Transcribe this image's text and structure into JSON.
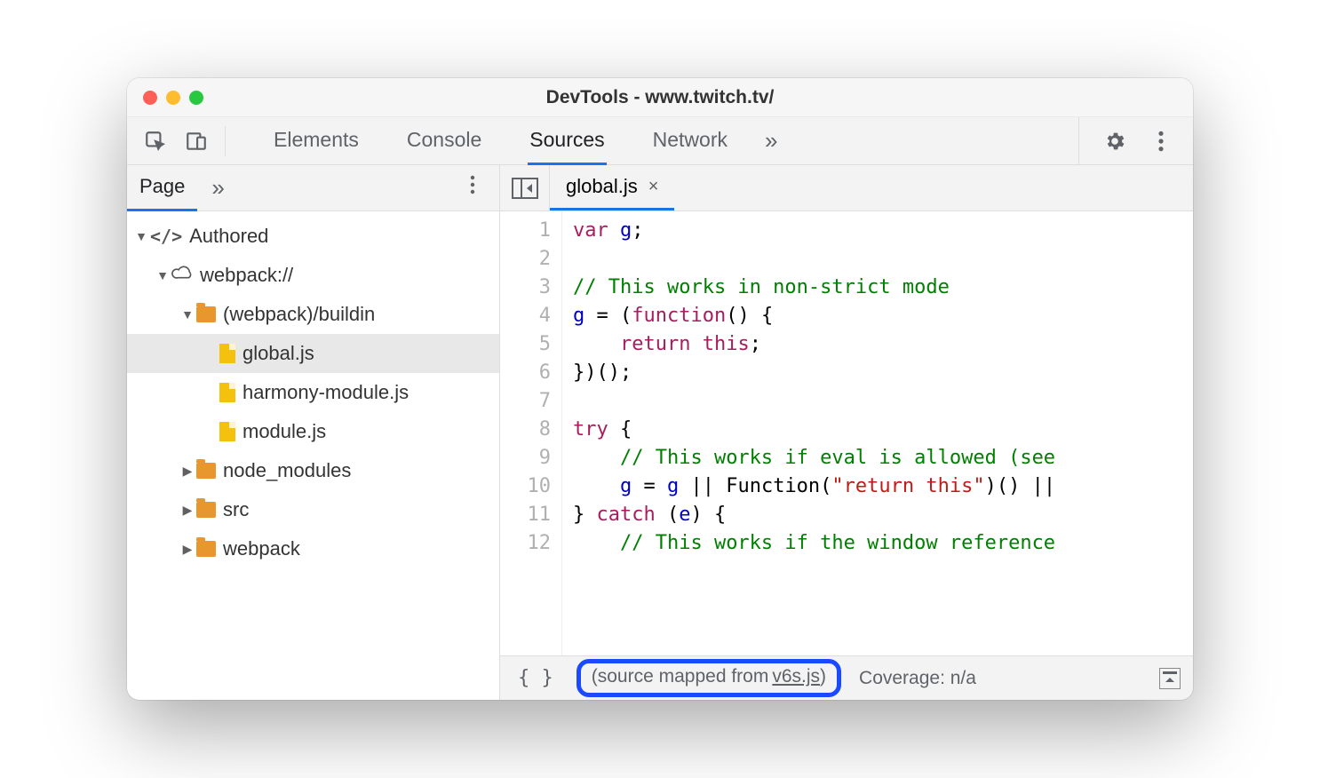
{
  "window": {
    "title": "DevTools - www.twitch.tv/"
  },
  "tabs": {
    "items": [
      "Elements",
      "Console",
      "Sources",
      "Network"
    ],
    "active_index": 2,
    "overflow_glyph": "»"
  },
  "sidebar": {
    "tab": "Page",
    "overflow_glyph": "»",
    "tree": {
      "root": {
        "label": "Authored"
      },
      "origin": {
        "label": "webpack://"
      },
      "folder_buildin": {
        "label": "(webpack)/buildin"
      },
      "files": [
        {
          "label": "global.js",
          "selected": true
        },
        {
          "label": "harmony-module.js",
          "selected": false
        },
        {
          "label": "module.js",
          "selected": false
        }
      ],
      "folders_collapsed": [
        {
          "label": "node_modules"
        },
        {
          "label": "src"
        },
        {
          "label": "webpack"
        }
      ]
    }
  },
  "editor": {
    "tab": {
      "label": "global.js",
      "close_glyph": "×"
    },
    "line_count": 12,
    "lines": [
      {
        "n": 1,
        "html": "<span class='kw'>var</span> <span class='ident'>g</span>;"
      },
      {
        "n": 2,
        "html": ""
      },
      {
        "n": 3,
        "html": "<span class='comment'>// This works in non-strict mode</span>"
      },
      {
        "n": 4,
        "html": "<span class='ident'>g</span> = (<span class='fn'>function</span>() {"
      },
      {
        "n": 5,
        "html": "    <span class='kw'>return</span> <span class='kw'>this</span>;"
      },
      {
        "n": 6,
        "html": "})();"
      },
      {
        "n": 7,
        "html": ""
      },
      {
        "n": 8,
        "html": "<span class='kw'>try</span> {"
      },
      {
        "n": 9,
        "html": "    <span class='comment'>// This works if eval is allowed (see</span>"
      },
      {
        "n": 10,
        "html": "    <span class='ident'>g</span> = <span class='ident'>g</span> || Function(<span class='str'>\"return this\"</span>)() ||"
      },
      {
        "n": 11,
        "html": "} <span class='kw'>catch</span> (<span class='ident'>e</span>) {"
      },
      {
        "n": 12,
        "html": "    <span class='comment'>// This works if the window reference</span>"
      }
    ]
  },
  "footer": {
    "pretty_print_glyph": "{ }",
    "mapped_prefix": "(source mapped from ",
    "mapped_link": "v6s.js",
    "mapped_suffix": ")",
    "coverage": "Coverage: n/a"
  }
}
